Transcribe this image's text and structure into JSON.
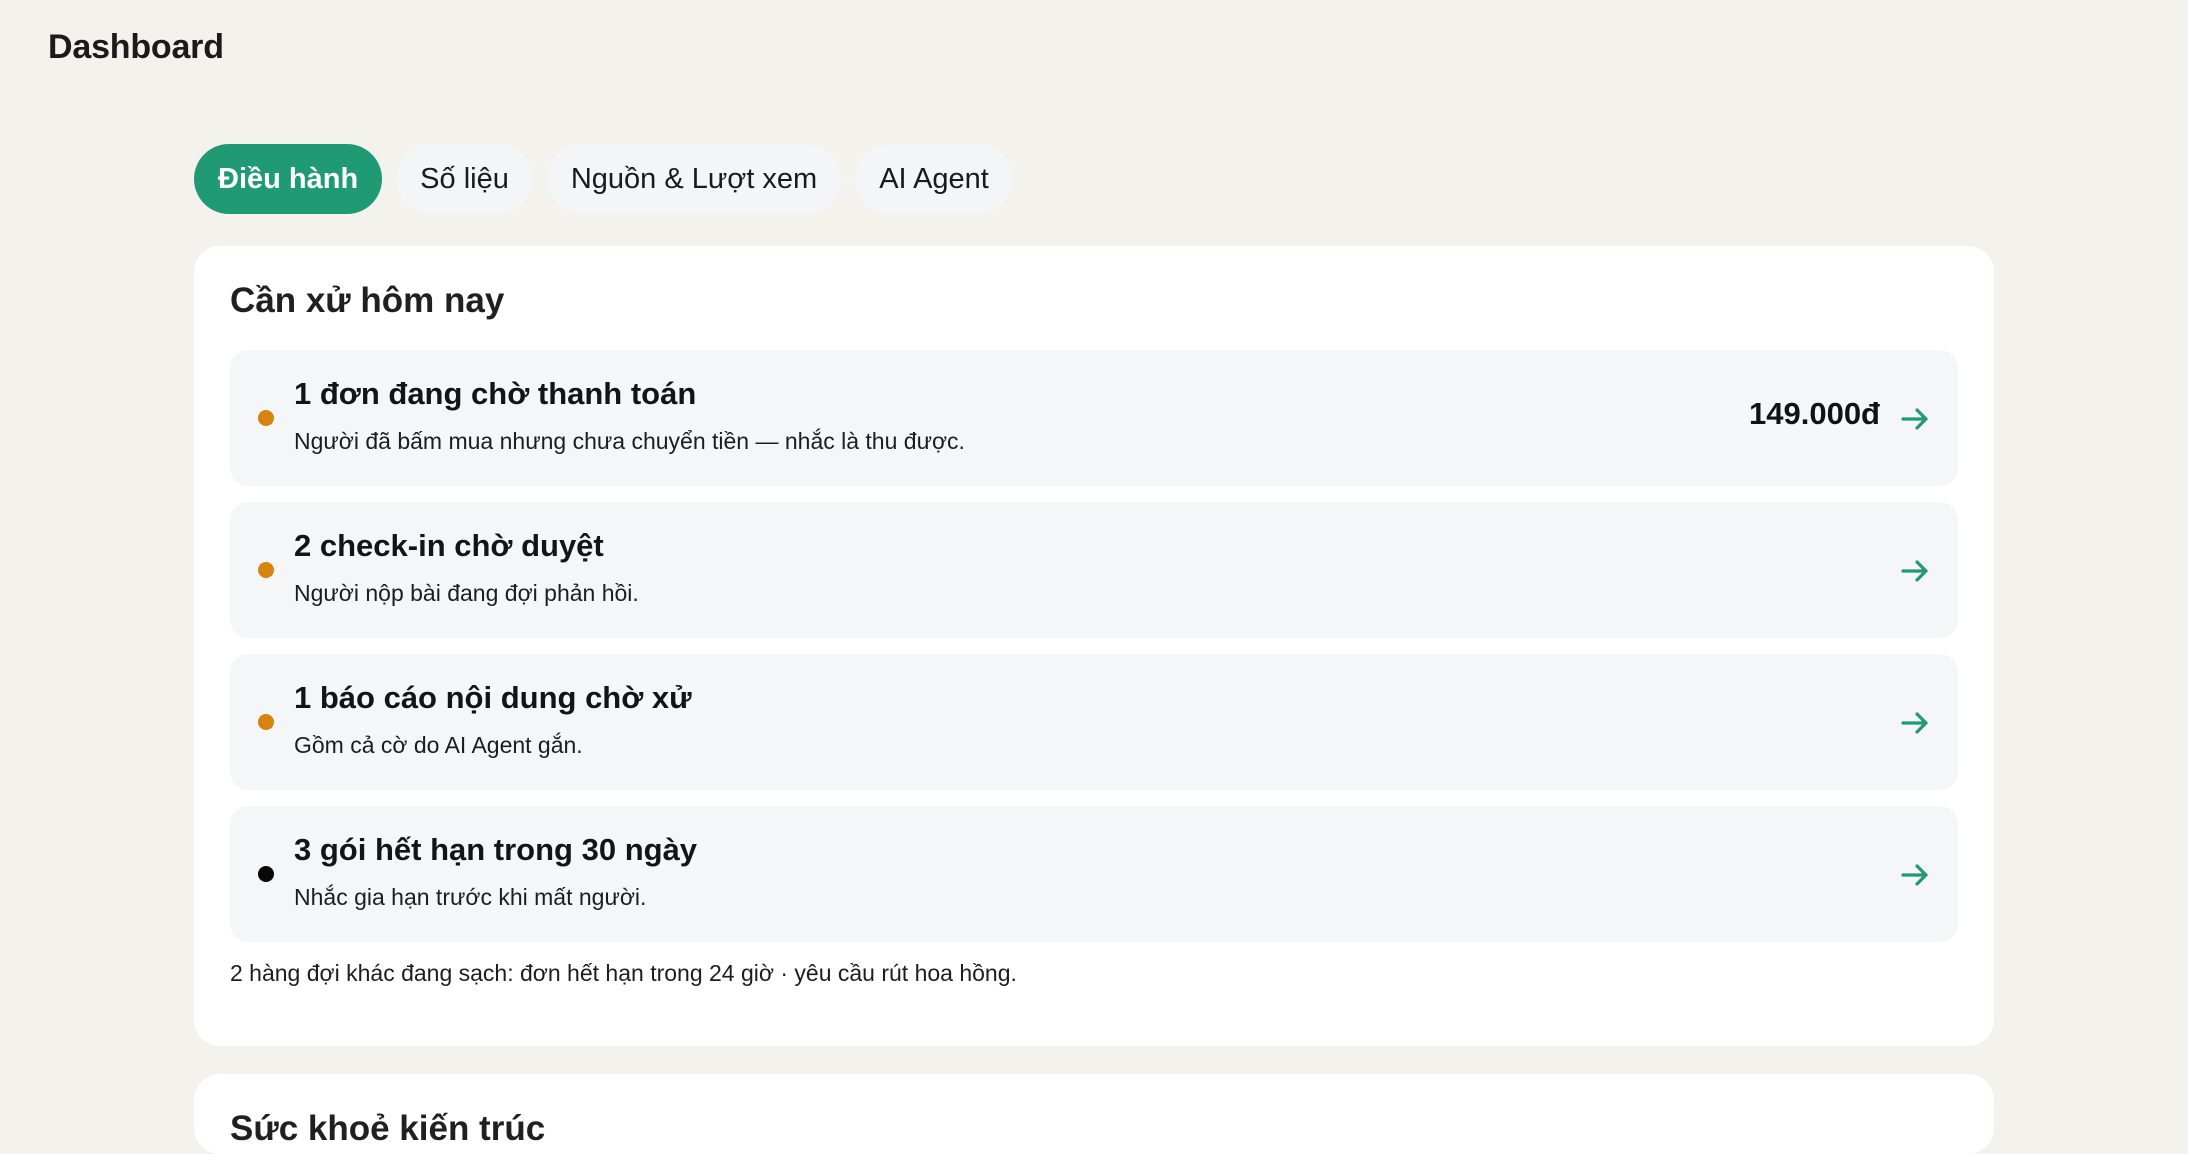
{
  "app": {
    "title": "Dashboard"
  },
  "tabs": [
    {
      "label": "Điều hành",
      "active": true
    },
    {
      "label": "Số liệu",
      "active": false
    },
    {
      "label": "Nguồn & Lượt xem",
      "active": false
    },
    {
      "label": "AI Agent",
      "active": false
    }
  ],
  "today_card": {
    "title": "Cần xử hôm nay",
    "items": [
      {
        "title": "1 đơn đang chờ thanh toán",
        "description": "Người đã bấm mua nhưng chưa chuyển tiền — nhắc là thu được.",
        "amount": "149.000đ",
        "dot_color": "#d8820f",
        "icon": "arrow-right-icon"
      },
      {
        "title": "2 check-in chờ duyệt",
        "description": "Người nộp bài đang đợi phản hồi.",
        "amount": "",
        "dot_color": "#d8820f",
        "icon": "arrow-right-icon"
      },
      {
        "title": "1 báo cáo nội dung chờ xử",
        "description": "Gồm cả cờ do AI Agent gắn.",
        "amount": "",
        "dot_color": "#d8820f",
        "icon": "arrow-right-icon"
      },
      {
        "title": "3 gói hết hạn trong 30 ngày",
        "description": "Nhắc gia hạn trước khi mất người.",
        "amount": "",
        "dot_color": "#080808",
        "icon": "arrow-right-icon"
      }
    ],
    "footer": "2 hàng đợi khác đang sạch: đơn hết hạn trong 24 giờ · yêu cầu rút hoa hồng."
  },
  "next_card": {
    "title": "Sức khoẻ kiến trúc"
  },
  "colors": {
    "accent": "#1f9a74",
    "warning": "#d8820f",
    "background": "#f3f2ec"
  }
}
